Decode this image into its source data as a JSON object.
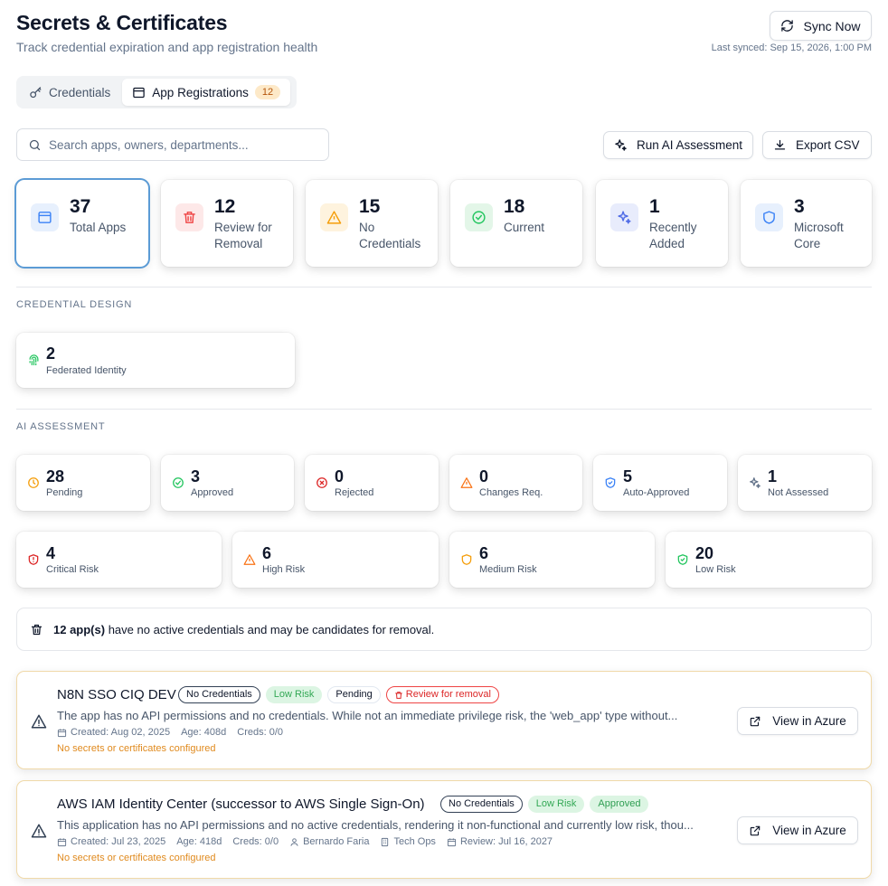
{
  "header": {
    "title": "Secrets & Certificates",
    "subtitle": "Track credential expiration and app registration health",
    "sync_label": "Sync Now",
    "last_synced": "Last synced: Sep 15, 2026, 1:00 PM"
  },
  "tabs": [
    {
      "label": "Credentials",
      "icon": "key-icon",
      "active": false
    },
    {
      "label": "App Registrations",
      "icon": "window-icon",
      "active": true,
      "badge": "12"
    }
  ],
  "toolbar": {
    "search_placeholder": "Search apps, owners, departments...",
    "ai_label": "Run AI Assessment",
    "export_label": "Export CSV"
  },
  "stats": [
    {
      "value": "37",
      "label": "Total Apps",
      "icon": "window-icon",
      "color": "#3b82f6",
      "selected": true
    },
    {
      "value": "12",
      "label": "Review for Removal",
      "icon": "trash-icon",
      "color": "#ef4444"
    },
    {
      "value": "15",
      "label": "No Credentials",
      "icon": "warning-icon",
      "color": "#f59e0b"
    },
    {
      "value": "18",
      "label": "Current",
      "icon": "check-circle-icon",
      "color": "#22c55e"
    },
    {
      "value": "1",
      "label": "Recently Added",
      "icon": "sparkles-icon",
      "color": "#6366f1"
    },
    {
      "value": "3",
      "label": "Microsoft Core",
      "icon": "shield-icon",
      "color": "#3b82f6"
    }
  ],
  "credential_design": {
    "section_label": "CREDENTIAL DESIGN",
    "items": [
      {
        "value": "2",
        "label": "Federated Identity",
        "icon": "fingerprint-icon",
        "color": "#22c55e"
      }
    ]
  },
  "ai_assessment": {
    "section_label": "AI ASSESSMENT",
    "status": [
      {
        "value": "28",
        "label": "Pending",
        "icon": "clock-icon",
        "color": "#f59e0b"
      },
      {
        "value": "3",
        "label": "Approved",
        "icon": "check-circle-icon",
        "color": "#22c55e"
      },
      {
        "value": "0",
        "label": "Rejected",
        "icon": "x-circle-icon",
        "color": "#dc2626"
      },
      {
        "value": "0",
        "label": "Changes Req.",
        "icon": "warning-icon",
        "color": "#f97316"
      },
      {
        "value": "5",
        "label": "Auto-Approved",
        "icon": "shield-check-icon",
        "color": "#3b82f6"
      },
      {
        "value": "1",
        "label": "Not Assessed",
        "icon": "sparkles-icon",
        "color": "#64748b"
      }
    ],
    "risk": [
      {
        "value": "4",
        "label": "Critical Risk",
        "icon": "shield-alert-icon",
        "color": "#dc2626"
      },
      {
        "value": "6",
        "label": "High Risk",
        "icon": "warning-icon",
        "color": "#f97316"
      },
      {
        "value": "6",
        "label": "Medium Risk",
        "icon": "shield-icon",
        "color": "#f59e0b"
      },
      {
        "value": "20",
        "label": "Low Risk",
        "icon": "shield-check-icon",
        "color": "#22c55e"
      }
    ]
  },
  "alert": {
    "count_text": "12 app(s)",
    "rest_text": " have no active credentials and may be candidates for removal."
  },
  "apps": [
    {
      "name": "N8N SSO CIQ DEV",
      "tags": [
        "No Credentials",
        "Low Risk",
        "Pending",
        "Review for removal"
      ],
      "description": "The app has no API permissions and no credentials. While not an immediate privilege risk, the 'web_app' type without...",
      "created": "Created: Aug 02, 2025",
      "age": "Age: 408d",
      "creds": "Creds: 0/0",
      "note": "No secrets or certificates configured",
      "action": "View in Azure"
    },
    {
      "name": "AWS IAM Identity Center (successor to AWS Single Sign-On)",
      "tags": [
        "No Credentials",
        "Low Risk",
        "Approved"
      ],
      "description": "This application has no API permissions and no active credentials, rendering it non-functional and currently low risk, thou...",
      "created": "Created: Jul 23, 2025",
      "age": "Age: 418d",
      "creds": "Creds: 0/0",
      "owner": "Bernardo Faria",
      "department": "Tech Ops",
      "review": "Review: Jul 16, 2027",
      "note": "No secrets or certificates configured",
      "action": "View in Azure"
    }
  ]
}
